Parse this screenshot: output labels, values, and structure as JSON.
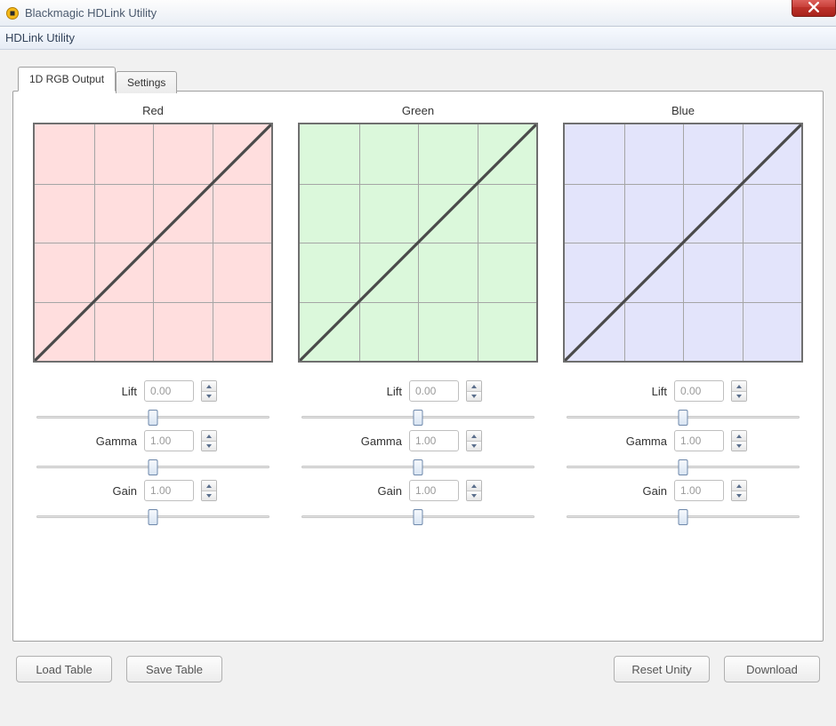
{
  "window": {
    "title": "Blackmagic HDLink Utility"
  },
  "menu": {
    "label": "HDLink Utility"
  },
  "tabs": [
    {
      "label": "1D RGB Output",
      "active": true
    },
    {
      "label": "Settings",
      "active": false
    }
  ],
  "channels": [
    {
      "name": "Red",
      "color_class": "curve-red",
      "lift_label": "Lift",
      "lift_value": "0.00",
      "gamma_label": "Gamma",
      "gamma_value": "1.00",
      "gain_label": "Gain",
      "gain_value": "1.00"
    },
    {
      "name": "Green",
      "color_class": "curve-green",
      "lift_label": "Lift",
      "lift_value": "0.00",
      "gamma_label": "Gamma",
      "gamma_value": "1.00",
      "gain_label": "Gain",
      "gain_value": "1.00"
    },
    {
      "name": "Blue",
      "color_class": "curve-blue",
      "lift_label": "Lift",
      "lift_value": "0.00",
      "gamma_label": "Gamma",
      "gamma_value": "1.00",
      "gain_label": "Gain",
      "gain_value": "1.00"
    }
  ],
  "buttons": {
    "load_table": "Load Table",
    "save_table": "Save Table",
    "reset_unity": "Reset Unity",
    "download": "Download"
  },
  "chart_data": [
    {
      "type": "line",
      "title": "Red",
      "xlabel": "",
      "ylabel": "",
      "x": [
        0,
        1
      ],
      "values": [
        0,
        1
      ],
      "xlim": [
        0,
        1
      ],
      "ylim": [
        0,
        1
      ],
      "grid_divisions": 4,
      "background": "#ffdede"
    },
    {
      "type": "line",
      "title": "Green",
      "xlabel": "",
      "ylabel": "",
      "x": [
        0,
        1
      ],
      "values": [
        0,
        1
      ],
      "xlim": [
        0,
        1
      ],
      "ylim": [
        0,
        1
      ],
      "grid_divisions": 4,
      "background": "#dbf8db"
    },
    {
      "type": "line",
      "title": "Blue",
      "xlabel": "",
      "ylabel": "",
      "x": [
        0,
        1
      ],
      "values": [
        0,
        1
      ],
      "xlim": [
        0,
        1
      ],
      "ylim": [
        0,
        1
      ],
      "grid_divisions": 4,
      "background": "#e3e4fb"
    }
  ]
}
